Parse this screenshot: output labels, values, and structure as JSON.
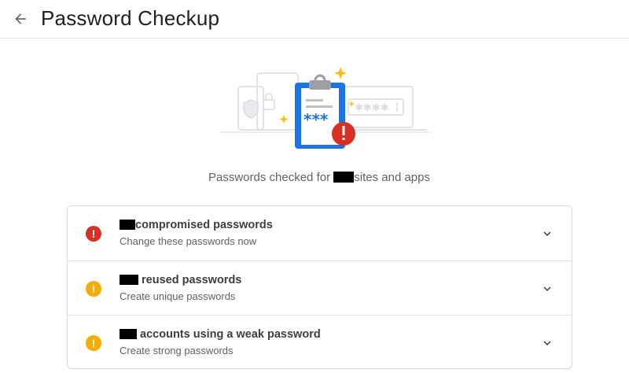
{
  "header": {
    "title": "Password Checkup"
  },
  "summary": {
    "prefix": "Passwords checked for",
    "suffix": "sites and apps"
  },
  "issues": [
    {
      "title": "compromised passwords",
      "subtitle": "Change these passwords now",
      "severity": "error"
    },
    {
      "title": "reused passwords",
      "subtitle": "Create unique passwords",
      "severity": "warning"
    },
    {
      "title": "accounts using a weak password",
      "subtitle": "Create strong passwords",
      "severity": "warning"
    }
  ],
  "colors": {
    "error": "#d93025",
    "warning": "#f9ab00",
    "accent": "#1a73e8"
  },
  "icons": {
    "back": "arrow-back-icon",
    "expand": "chevron-down-icon",
    "error": "error-icon",
    "warning": "warning-icon"
  }
}
